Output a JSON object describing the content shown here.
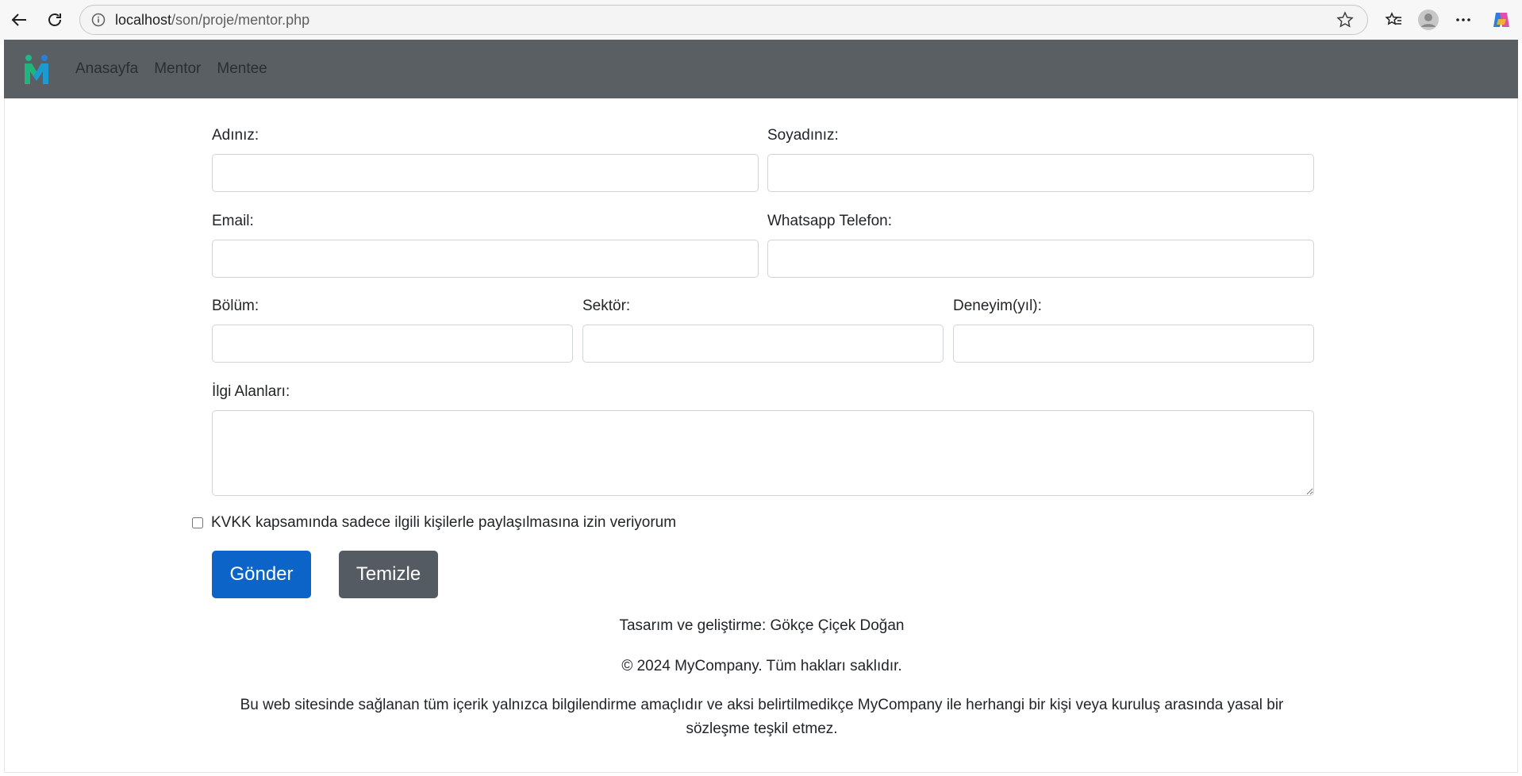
{
  "browser": {
    "url_host": "localhost",
    "url_path": "/son/proje/mentor.php"
  },
  "navbar": {
    "links": [
      "Anasayfa",
      "Mentor",
      "Mentee"
    ]
  },
  "form": {
    "first_name_label": "Adınız:",
    "last_name_label": "Soyadınız:",
    "email_label": "Email:",
    "phone_label": "Whatsapp Telefon:",
    "department_label": "Bölüm:",
    "sector_label": "Sektör:",
    "experience_label": "Deneyim(yıl):",
    "interests_label": "İlgi Alanları:",
    "consent_label": "KVKK kapsamında sadece ilgili kişilerle paylaşılmasına izin veriyorum",
    "submit_label": "Gönder",
    "reset_label": "Temizle"
  },
  "footer": {
    "credit": "Tasarım ve geliştirme: Gökçe Çiçek Doğan",
    "copyright": "© 2024 MyCompany. Tüm hakları saklıdır.",
    "disclaimer": "Bu web sitesinde sağlanan tüm içerik yalnızca bilgilendirme amaçlıdır ve aksi belirtilmedikçe MyCompany ile herhangi bir kişi veya kuruluş arasında yasal bir sözleşme teşkil etmez."
  },
  "colors": {
    "navbar_bg": "#5a5f63",
    "primary_button": "#0d64c8",
    "secondary_button": "#545b62"
  }
}
